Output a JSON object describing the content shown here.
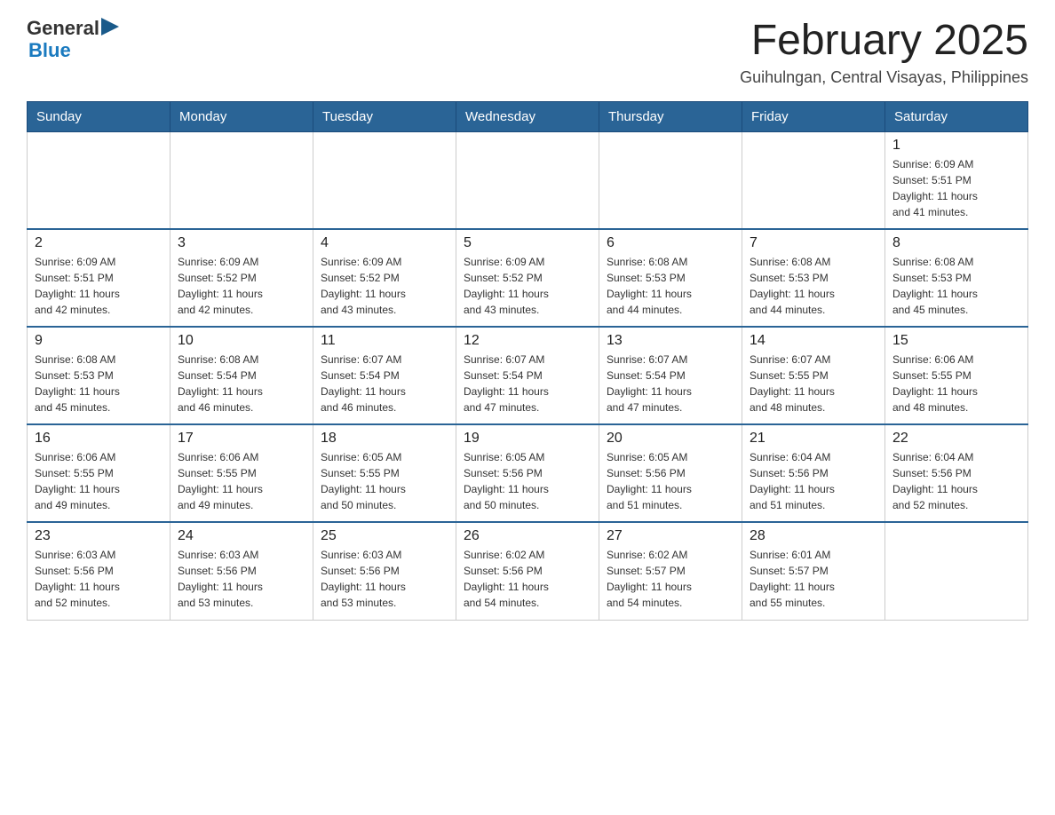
{
  "header": {
    "logo_text_general": "General",
    "logo_text_blue": "Blue",
    "month_year": "February 2025",
    "location": "Guihulngan, Central Visayas, Philippines"
  },
  "days_of_week": [
    "Sunday",
    "Monday",
    "Tuesday",
    "Wednesday",
    "Thursday",
    "Friday",
    "Saturday"
  ],
  "weeks": [
    [
      {
        "day": "",
        "info": ""
      },
      {
        "day": "",
        "info": ""
      },
      {
        "day": "",
        "info": ""
      },
      {
        "day": "",
        "info": ""
      },
      {
        "day": "",
        "info": ""
      },
      {
        "day": "",
        "info": ""
      },
      {
        "day": "1",
        "info": "Sunrise: 6:09 AM\nSunset: 5:51 PM\nDaylight: 11 hours\nand 41 minutes."
      }
    ],
    [
      {
        "day": "2",
        "info": "Sunrise: 6:09 AM\nSunset: 5:51 PM\nDaylight: 11 hours\nand 42 minutes."
      },
      {
        "day": "3",
        "info": "Sunrise: 6:09 AM\nSunset: 5:52 PM\nDaylight: 11 hours\nand 42 minutes."
      },
      {
        "day": "4",
        "info": "Sunrise: 6:09 AM\nSunset: 5:52 PM\nDaylight: 11 hours\nand 43 minutes."
      },
      {
        "day": "5",
        "info": "Sunrise: 6:09 AM\nSunset: 5:52 PM\nDaylight: 11 hours\nand 43 minutes."
      },
      {
        "day": "6",
        "info": "Sunrise: 6:08 AM\nSunset: 5:53 PM\nDaylight: 11 hours\nand 44 minutes."
      },
      {
        "day": "7",
        "info": "Sunrise: 6:08 AM\nSunset: 5:53 PM\nDaylight: 11 hours\nand 44 minutes."
      },
      {
        "day": "8",
        "info": "Sunrise: 6:08 AM\nSunset: 5:53 PM\nDaylight: 11 hours\nand 45 minutes."
      }
    ],
    [
      {
        "day": "9",
        "info": "Sunrise: 6:08 AM\nSunset: 5:53 PM\nDaylight: 11 hours\nand 45 minutes."
      },
      {
        "day": "10",
        "info": "Sunrise: 6:08 AM\nSunset: 5:54 PM\nDaylight: 11 hours\nand 46 minutes."
      },
      {
        "day": "11",
        "info": "Sunrise: 6:07 AM\nSunset: 5:54 PM\nDaylight: 11 hours\nand 46 minutes."
      },
      {
        "day": "12",
        "info": "Sunrise: 6:07 AM\nSunset: 5:54 PM\nDaylight: 11 hours\nand 47 minutes."
      },
      {
        "day": "13",
        "info": "Sunrise: 6:07 AM\nSunset: 5:54 PM\nDaylight: 11 hours\nand 47 minutes."
      },
      {
        "day": "14",
        "info": "Sunrise: 6:07 AM\nSunset: 5:55 PM\nDaylight: 11 hours\nand 48 minutes."
      },
      {
        "day": "15",
        "info": "Sunrise: 6:06 AM\nSunset: 5:55 PM\nDaylight: 11 hours\nand 48 minutes."
      }
    ],
    [
      {
        "day": "16",
        "info": "Sunrise: 6:06 AM\nSunset: 5:55 PM\nDaylight: 11 hours\nand 49 minutes."
      },
      {
        "day": "17",
        "info": "Sunrise: 6:06 AM\nSunset: 5:55 PM\nDaylight: 11 hours\nand 49 minutes."
      },
      {
        "day": "18",
        "info": "Sunrise: 6:05 AM\nSunset: 5:55 PM\nDaylight: 11 hours\nand 50 minutes."
      },
      {
        "day": "19",
        "info": "Sunrise: 6:05 AM\nSunset: 5:56 PM\nDaylight: 11 hours\nand 50 minutes."
      },
      {
        "day": "20",
        "info": "Sunrise: 6:05 AM\nSunset: 5:56 PM\nDaylight: 11 hours\nand 51 minutes."
      },
      {
        "day": "21",
        "info": "Sunrise: 6:04 AM\nSunset: 5:56 PM\nDaylight: 11 hours\nand 51 minutes."
      },
      {
        "day": "22",
        "info": "Sunrise: 6:04 AM\nSunset: 5:56 PM\nDaylight: 11 hours\nand 52 minutes."
      }
    ],
    [
      {
        "day": "23",
        "info": "Sunrise: 6:03 AM\nSunset: 5:56 PM\nDaylight: 11 hours\nand 52 minutes."
      },
      {
        "day": "24",
        "info": "Sunrise: 6:03 AM\nSunset: 5:56 PM\nDaylight: 11 hours\nand 53 minutes."
      },
      {
        "day": "25",
        "info": "Sunrise: 6:03 AM\nSunset: 5:56 PM\nDaylight: 11 hours\nand 53 minutes."
      },
      {
        "day": "26",
        "info": "Sunrise: 6:02 AM\nSunset: 5:56 PM\nDaylight: 11 hours\nand 54 minutes."
      },
      {
        "day": "27",
        "info": "Sunrise: 6:02 AM\nSunset: 5:57 PM\nDaylight: 11 hours\nand 54 minutes."
      },
      {
        "day": "28",
        "info": "Sunrise: 6:01 AM\nSunset: 5:57 PM\nDaylight: 11 hours\nand 55 minutes."
      },
      {
        "day": "",
        "info": ""
      }
    ]
  ]
}
